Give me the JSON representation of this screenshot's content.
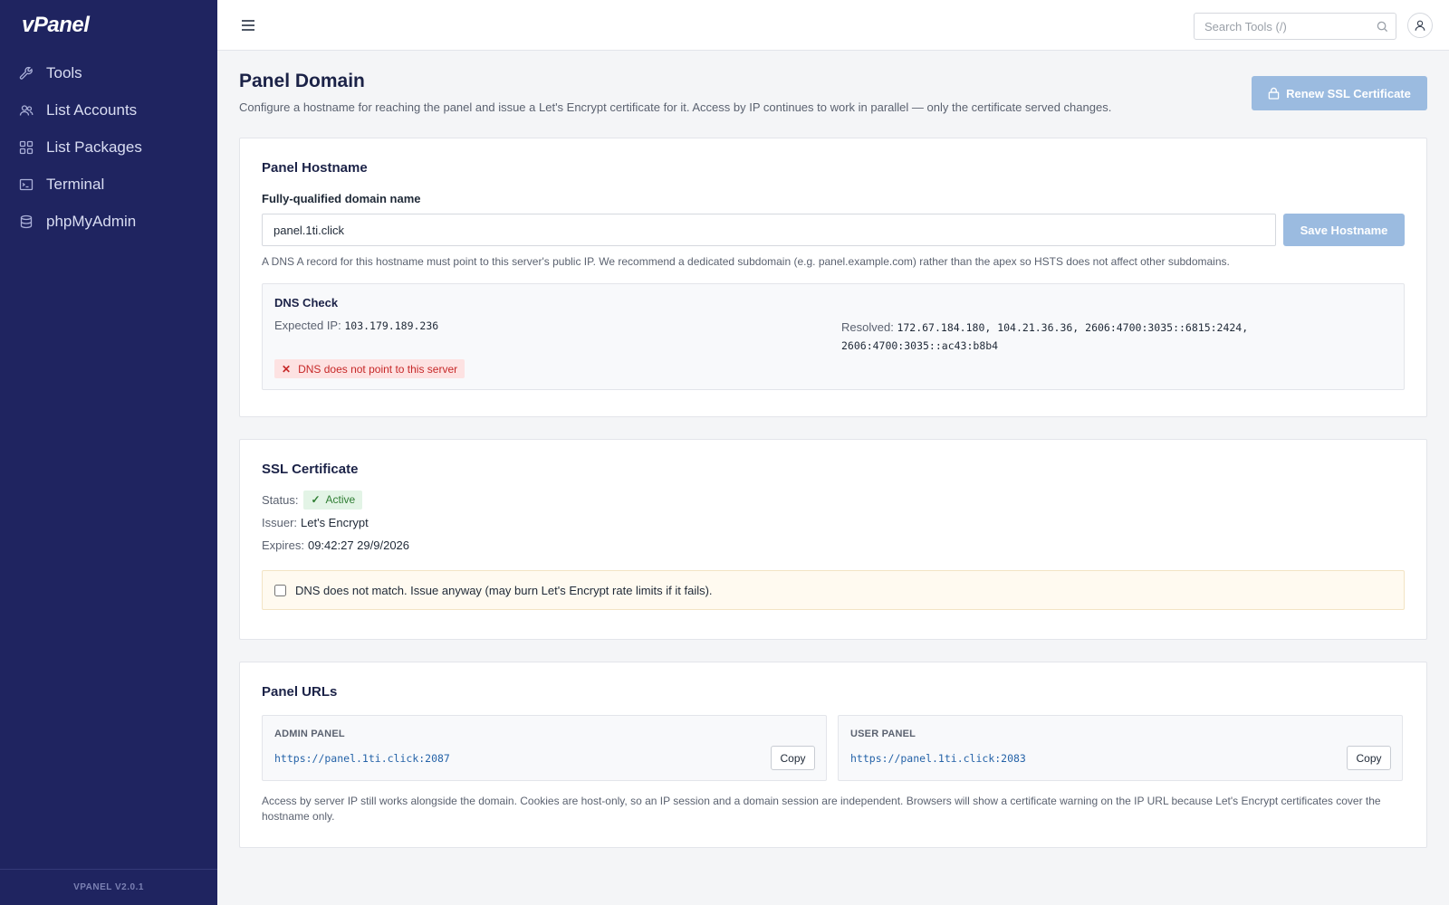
{
  "app": {
    "logo": "vPanel",
    "version": "VPANEL V2.0.1"
  },
  "sidebar": {
    "items": [
      {
        "label": "Tools",
        "icon": "wrench-icon"
      },
      {
        "label": "List Accounts",
        "icon": "users-icon"
      },
      {
        "label": "List Packages",
        "icon": "grid-icon"
      },
      {
        "label": "Terminal",
        "icon": "terminal-icon"
      },
      {
        "label": "phpMyAdmin",
        "icon": "database-icon"
      }
    ]
  },
  "topbar": {
    "search_placeholder": "Search Tools (/)"
  },
  "page": {
    "title": "Panel Domain",
    "description": "Configure a hostname for reaching the panel and issue a Let's Encrypt certificate for it. Access by IP continues to work in parallel — only the certificate served changes.",
    "renew_label": "Renew SSL Certificate"
  },
  "hostname": {
    "title": "Panel Hostname",
    "field_label": "Fully-qualified domain name",
    "value": "panel.1ti.click",
    "save_label": "Save Hostname",
    "help": "A DNS A record for this hostname must point to this server's public IP. We recommend a dedicated subdomain (e.g. panel.example.com) rather than the apex so HSTS does not affect other subdomains."
  },
  "dns": {
    "title": "DNS Check",
    "expected_label": "Expected IP:",
    "expected_value": "103.179.189.236",
    "resolved_label": "Resolved:",
    "resolved_value": "172.67.184.180, 104.21.36.36, 2606:4700:3035::6815:2424, 2606:4700:3035::ac43:b8b4",
    "status": "DNS does not point to this server"
  },
  "ssl": {
    "title": "SSL Certificate",
    "status_label": "Status:",
    "status_value": "Active",
    "issuer_label": "Issuer:",
    "issuer_value": "Let's Encrypt",
    "expires_label": "Expires:",
    "expires_value": "09:42:27 29/9/2026",
    "override_label": "DNS does not match. Issue anyway (may burn Let's Encrypt rate limits if it fails)."
  },
  "urls": {
    "title": "Panel URLs",
    "admin_label": "ADMIN PANEL",
    "admin_url": "https://panel.1ti.click:2087",
    "user_label": "USER PANEL",
    "user_url": "https://panel.1ti.click:2083",
    "copy_label": "Copy",
    "note": "Access by server IP still works alongside the domain. Cookies are host-only, so an IP session and a domain session are independent. Browsers will show a certificate warning on the IP URL because Let's Encrypt certificates cover the hostname only."
  },
  "colors": {
    "sidebar_bg": "#1f2460",
    "primary_disabled": "#9bbbe0",
    "error": "#c62828",
    "success": "#2e7d32"
  }
}
